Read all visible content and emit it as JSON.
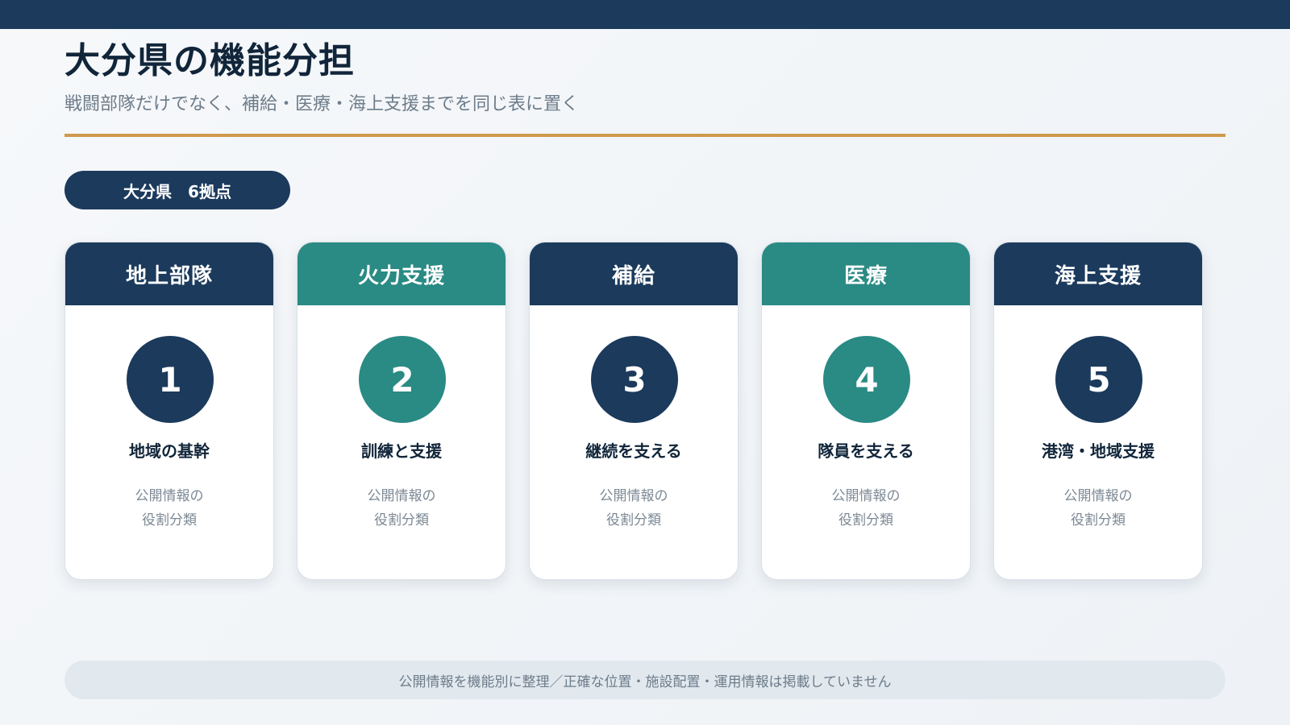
{
  "header": {
    "title": "大分県の機能分担",
    "subtitle": "戦闘部隊だけでなく、補給・医療・海上支援までを同じ表に置く"
  },
  "badge": {
    "label": "大分県　6拠点"
  },
  "colors": {
    "navy": "#1b3a5c",
    "teal": "#2a8a84",
    "accent": "#cf9a4c"
  },
  "cards": [
    {
      "header": "地上部隊",
      "number": "1",
      "role": "地域の基幹",
      "note_line1": "公開情報の",
      "note_line2": "役割分類",
      "color": "#1b3a5c"
    },
    {
      "header": "火力支援",
      "number": "2",
      "role": "訓練と支援",
      "note_line1": "公開情報の",
      "note_line2": "役割分類",
      "color": "#2a8a84"
    },
    {
      "header": "補給",
      "number": "3",
      "role": "継続を支える",
      "note_line1": "公開情報の",
      "note_line2": "役割分類",
      "color": "#1b3a5c"
    },
    {
      "header": "医療",
      "number": "4",
      "role": "隊員を支える",
      "note_line1": "公開情報の",
      "note_line2": "役割分類",
      "color": "#2a8a84"
    },
    {
      "header": "海上支援",
      "number": "5",
      "role": "港湾・地域支援",
      "note_line1": "公開情報の",
      "note_line2": "役割分類",
      "color": "#1b3a5c"
    }
  ],
  "footer": {
    "text": "公開情報を機能別に整理／正確な位置・施設配置・運用情報は掲載していません"
  }
}
